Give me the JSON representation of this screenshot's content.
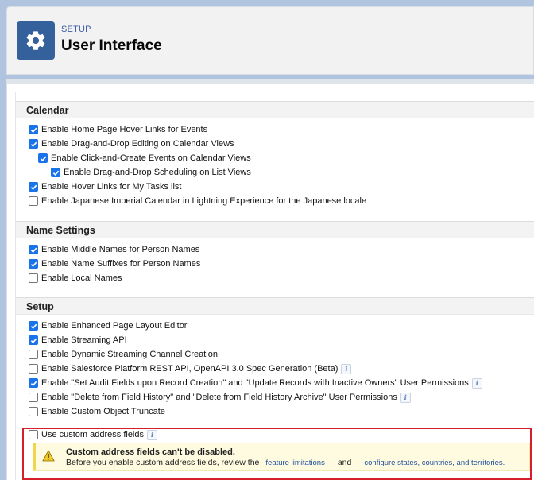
{
  "header": {
    "supertitle": "SETUP",
    "title": "User Interface",
    "icon": "gear-icon"
  },
  "sections": {
    "calendar": {
      "title": "Calendar",
      "items": [
        {
          "label": "Enable Home Page Hover Links for Events",
          "checked": true
        },
        {
          "label": "Enable Drag-and-Drop Editing on Calendar Views",
          "checked": true
        },
        {
          "label": "Enable Click-and-Create Events on Calendar Views",
          "checked": true
        },
        {
          "label": "Enable Drag-and-Drop Scheduling on List Views",
          "checked": true
        },
        {
          "label": "Enable Hover Links for My Tasks list",
          "checked": true
        },
        {
          "label": "Enable Japanese Imperial Calendar in Lightning Experience for the Japanese locale",
          "checked": false
        }
      ]
    },
    "name_settings": {
      "title": "Name Settings",
      "items": [
        {
          "label": "Enable Middle Names for Person Names",
          "checked": true
        },
        {
          "label": "Enable Name Suffixes for Person Names",
          "checked": true
        },
        {
          "label": "Enable Local Names",
          "checked": false
        }
      ]
    },
    "setup": {
      "title": "Setup",
      "items": [
        {
          "label": "Enable Enhanced Page Layout Editor",
          "checked": true
        },
        {
          "label": "Enable Streaming API",
          "checked": true
        },
        {
          "label": "Enable Dynamic Streaming Channel Creation",
          "checked": false
        },
        {
          "label": "Enable Salesforce Platform REST API, OpenAPI 3.0 Spec Generation (Beta)",
          "checked": false,
          "info": true
        },
        {
          "label": "Enable \"Set Audit Fields upon Record Creation\" and \"Update Records with Inactive Owners\" User Permissions",
          "checked": true,
          "info": true
        },
        {
          "label": "Enable \"Delete from Field History\" and \"Delete from Field History Archive\" User Permissions",
          "checked": false,
          "info": true
        },
        {
          "label": "Enable Custom Object Truncate",
          "checked": false
        }
      ]
    }
  },
  "custom_address": {
    "label": "Use custom address fields",
    "checked": false,
    "info": true,
    "warning": {
      "icon": "warning-icon",
      "title": "Custom address fields can't be disabled.",
      "text_before": "Before you enable custom address fields, review the",
      "link1": "feature limitations",
      "text_mid": "and",
      "link2": "configure states, countries, and territories."
    }
  },
  "colors": {
    "accent": "#1a73e8",
    "header_icon_bg": "#34609b",
    "highlight_border": "#d5202c",
    "warning_bg": "#fffbe0"
  }
}
